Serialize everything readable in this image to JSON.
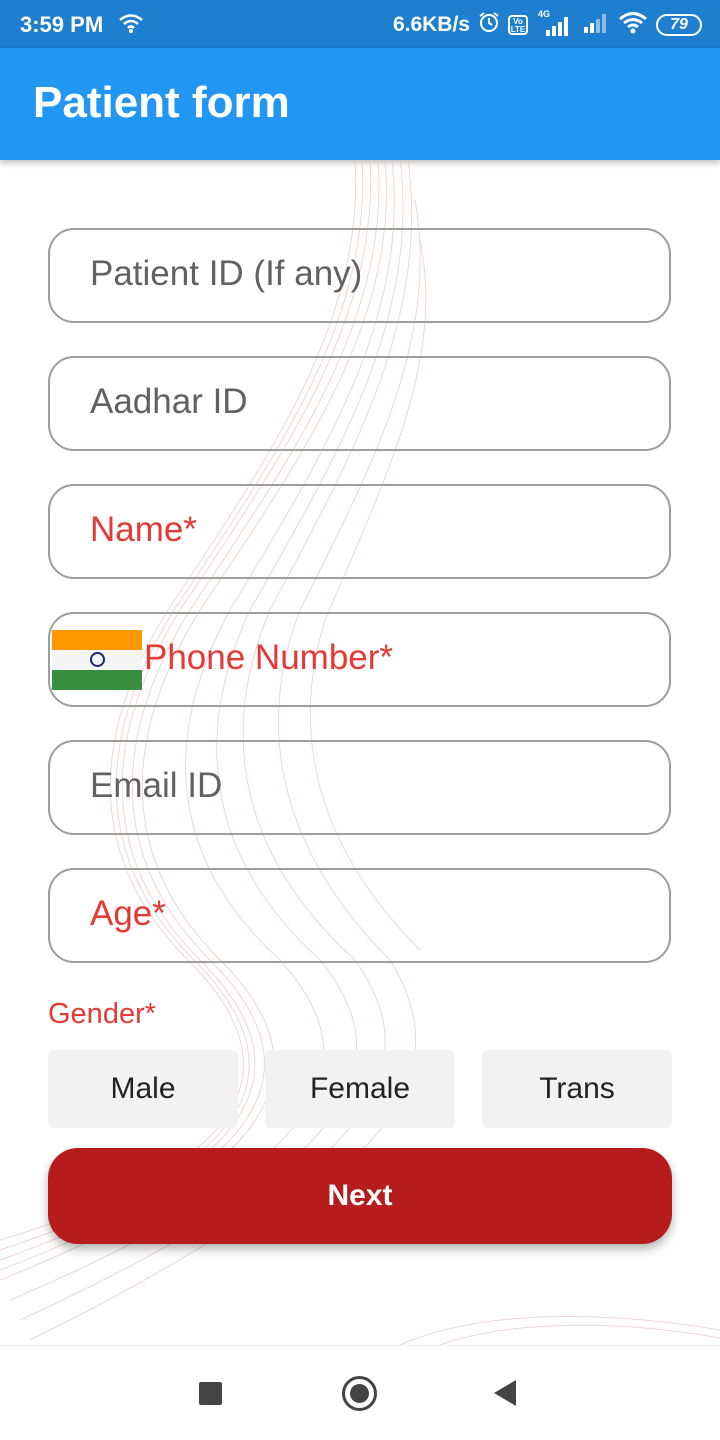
{
  "status_bar": {
    "time": "3:59 PM",
    "net_speed": "6.6KB/s",
    "network_type": "4G",
    "volte_label": "Vo LTE",
    "battery": "79",
    "icons": [
      "wifi-icon",
      "alarm-icon",
      "volte-icon",
      "signal-icon",
      "signal-icon",
      "wifi-icon",
      "battery-icon"
    ]
  },
  "app_bar": {
    "title": "Patient form"
  },
  "form": {
    "patient_id_placeholder": "Patient ID (If any)",
    "aadhar_placeholder": "Aadhar ID",
    "name_placeholder": "Name*",
    "phone_placeholder": "Phone Number*",
    "email_placeholder": "Email ID",
    "age_placeholder": "Age*",
    "gender_label": "Gender*",
    "gender_options": [
      "Male",
      "Female",
      "Trans"
    ],
    "next_label": "Next",
    "country_flag": "india-flag-icon"
  },
  "colors": {
    "status_bar": "#1e7fd0",
    "app_bar": "#2196f3",
    "required": "#e53935",
    "next_button": "#b71c1c"
  },
  "nav_bar": {
    "icons": [
      "recents-square-icon",
      "home-circle-icon",
      "back-triangle-icon"
    ]
  }
}
